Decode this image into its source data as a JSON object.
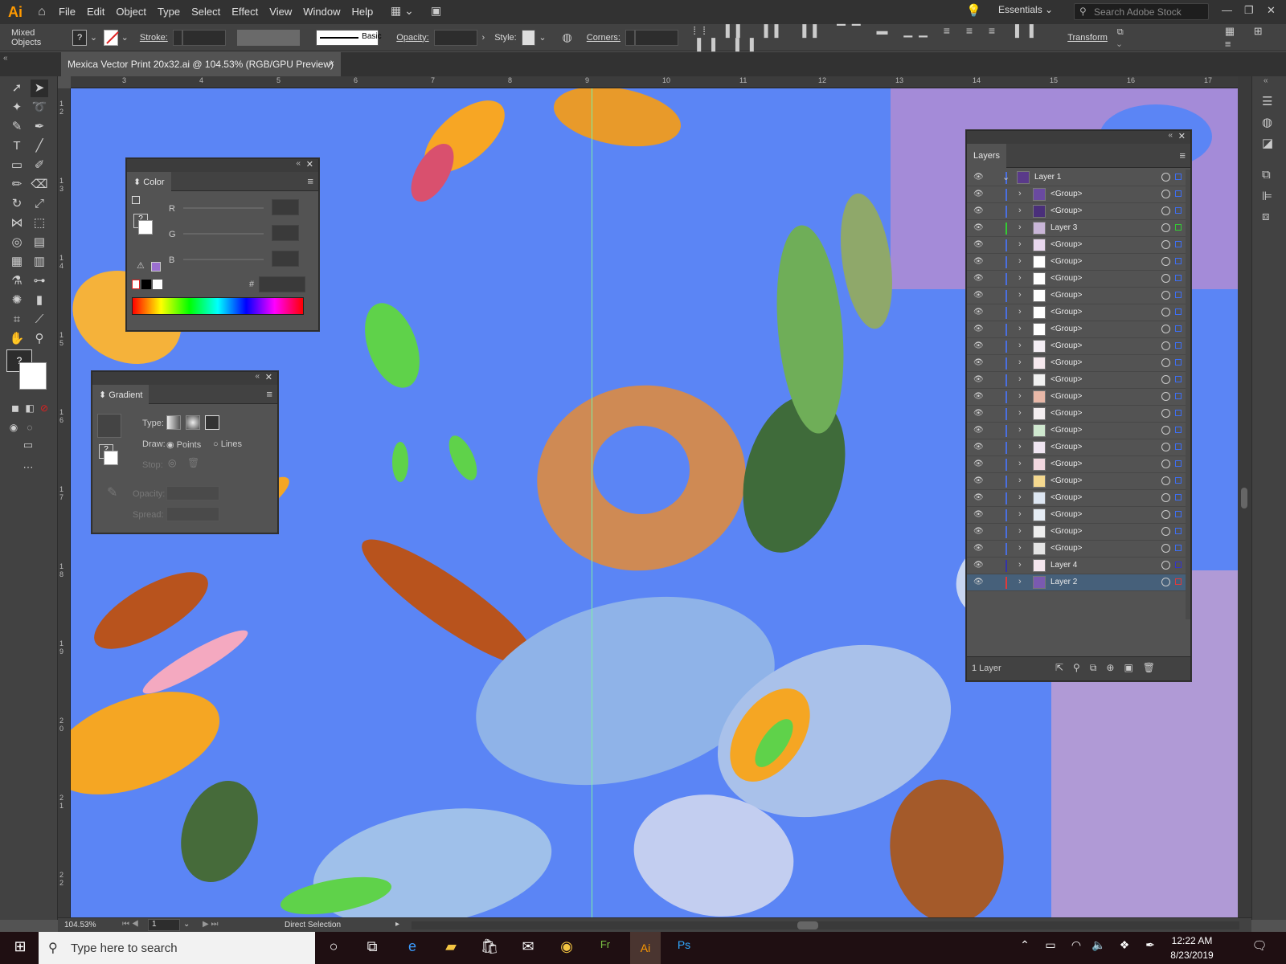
{
  "app": {
    "logo": "Ai",
    "menu": [
      "File",
      "Edit",
      "Object",
      "Type",
      "Select",
      "Effect",
      "View",
      "Window",
      "Help"
    ],
    "workspace": "Essentials",
    "search_placeholder": "Search Adobe Stock"
  },
  "control_bar": {
    "selection_type": "Mixed Objects",
    "fill_label": "?",
    "stroke_label": "Stroke:",
    "brush_label": "Basic",
    "opacity_label": "Opacity:",
    "style_label": "Style:",
    "corners_label": "Corners:",
    "transform_label": "Transform"
  },
  "document": {
    "tab_title": "Mexica Vector Print 20x32.ai @ 104.53% (RGB/GPU Preview)",
    "close": "×"
  },
  "rulers": {
    "top_ticks": [
      "3",
      "4",
      "5",
      "6",
      "7",
      "8",
      "9",
      "10",
      "11",
      "12",
      "13",
      "14",
      "15",
      "16",
      "17"
    ],
    "left_ticks": [
      "1 2",
      "1 3",
      "1 4",
      "1 5",
      "1 6",
      "1 7",
      "1 8",
      "1 9",
      "2 0",
      "2 1",
      "2 2"
    ]
  },
  "color_panel": {
    "title": "Color",
    "channels": [
      "R",
      "G",
      "B"
    ],
    "hex_label": "#",
    "indicator": "?"
  },
  "gradient_panel": {
    "title": "Gradient",
    "type_label": "Type:",
    "draw_label": "Draw:",
    "points_label": "Points",
    "lines_label": "Lines",
    "stop_label": "Stop:",
    "opacity_label": "Opacity:",
    "spread_label": "Spread:",
    "indicator": "?"
  },
  "layers_panel": {
    "title": "Layers",
    "footer": "1 Layer",
    "rows": [
      {
        "name": "Layer 1",
        "level": 0,
        "expanded": true,
        "bar": "#4a6fe0",
        "sel": "#3d6ff5",
        "thumb": "#5a3a8a"
      },
      {
        "name": "<Group>",
        "level": 1,
        "bar": "#4a6fe0",
        "sel": "#3d6ff5",
        "thumb": "#6a4aa0"
      },
      {
        "name": "<Group>",
        "level": 1,
        "bar": "#4a6fe0",
        "sel": "#3d6ff5",
        "thumb": "#4a2f7a"
      },
      {
        "name": "Layer 3",
        "level": 1,
        "bar": "#33cc33",
        "sel": "#33cc33",
        "thumb": "#c9b6d8"
      },
      {
        "name": "<Group>",
        "level": 1,
        "bar": "#4a6fe0",
        "sel": "#3d6ff5",
        "thumb": "#e9d8ef"
      },
      {
        "name": "<Group>",
        "level": 1,
        "bar": "#4a6fe0",
        "sel": "#3d6ff5",
        "thumb": "#ffffff"
      },
      {
        "name": "<Group>",
        "level": 1,
        "bar": "#4a6fe0",
        "sel": "#3d6ff5",
        "thumb": "#ffffff"
      },
      {
        "name": "<Group>",
        "level": 1,
        "bar": "#4a6fe0",
        "sel": "#3d6ff5",
        "thumb": "#ffffff"
      },
      {
        "name": "<Group>",
        "level": 1,
        "bar": "#4a6fe0",
        "sel": "#3d6ff5",
        "thumb": "#ffffff"
      },
      {
        "name": "<Group>",
        "level": 1,
        "bar": "#4a6fe0",
        "sel": "#3d6ff5",
        "thumb": "#ffffff"
      },
      {
        "name": "<Group>",
        "level": 1,
        "bar": "#4a6fe0",
        "sel": "#3d6ff5",
        "thumb": "#f4eef4"
      },
      {
        "name": "<Group>",
        "level": 1,
        "bar": "#4a6fe0",
        "sel": "#3d6ff5",
        "thumb": "#f6e9ee"
      },
      {
        "name": "<Group>",
        "level": 1,
        "bar": "#4a6fe0",
        "sel": "#3d6ff5",
        "thumb": "#f1f1f1"
      },
      {
        "name": "<Group>",
        "level": 1,
        "bar": "#4a6fe0",
        "sel": "#3d6ff5",
        "thumb": "#e8b8a8"
      },
      {
        "name": "<Group>",
        "level": 1,
        "bar": "#4a6fe0",
        "sel": "#3d6ff5",
        "thumb": "#f3eef0"
      },
      {
        "name": "<Group>",
        "level": 1,
        "bar": "#4a6fe0",
        "sel": "#3d6ff5",
        "thumb": "#cfe8cf"
      },
      {
        "name": "<Group>",
        "level": 1,
        "bar": "#4a6fe0",
        "sel": "#3d6ff5",
        "thumb": "#f0e6f2"
      },
      {
        "name": "<Group>",
        "level": 1,
        "bar": "#4a6fe0",
        "sel": "#3d6ff5",
        "thumb": "#f2d8e0"
      },
      {
        "name": "<Group>",
        "level": 1,
        "bar": "#4a6fe0",
        "sel": "#3d6ff5",
        "thumb": "#f5d98f"
      },
      {
        "name": "<Group>",
        "level": 1,
        "bar": "#4a6fe0",
        "sel": "#3d6ff5",
        "thumb": "#dde6f2"
      },
      {
        "name": "<Group>",
        "level": 1,
        "bar": "#4a6fe0",
        "sel": "#3d6ff5",
        "thumb": "#e6edf5"
      },
      {
        "name": "<Group>",
        "level": 1,
        "bar": "#4a6fe0",
        "sel": "#3d6ff5",
        "thumb": "#eeeeee"
      },
      {
        "name": "<Group>",
        "level": 1,
        "bar": "#4a6fe0",
        "sel": "#3d6ff5",
        "thumb": "#e4e4e4"
      },
      {
        "name": "Layer 4",
        "level": 1,
        "bar": "#3333aa",
        "sel": "#3333cc",
        "thumb": "#f5e6ee"
      },
      {
        "name": "Layer 2",
        "level": 1,
        "bar": "#e23a3a",
        "sel": "#e23a3a",
        "thumb": "#7a5ab0",
        "selected": true
      }
    ]
  },
  "status": {
    "zoom": "104.53%",
    "artboard": "1",
    "tool": "Direct Selection"
  },
  "taskbar": {
    "search_placeholder": "Type here to search",
    "time": "12:22 AM",
    "date": "8/23/2019"
  },
  "colors": {
    "canvas_bg": "#5b85f5",
    "panel_bg": "#535353",
    "ui_dark": "#323232",
    "accent_orange": "#ff9a00"
  }
}
